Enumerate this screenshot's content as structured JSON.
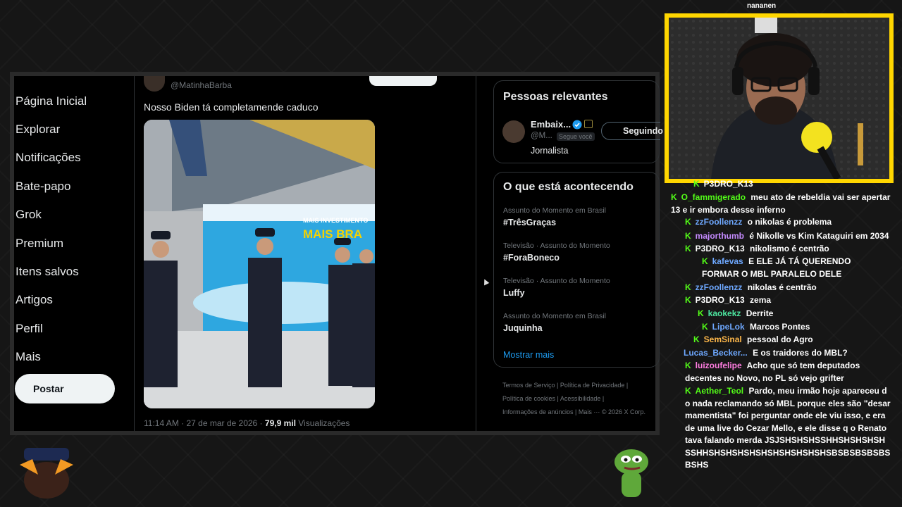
{
  "nav": {
    "items": [
      "Página Inicial",
      "Explorar",
      "Notificações",
      "Bate-papo",
      "Grok",
      "Premium",
      "Itens salvos",
      "Artigos",
      "Perfil",
      "Mais"
    ],
    "post_button": "Postar"
  },
  "tweet": {
    "handle": "@MatinhaBarba",
    "text": "Nosso Biden tá completamende caduco",
    "time": "11:14 AM · 27 de mar de 2026 ·",
    "views_count": "79,9 mil",
    "views_label": "Visualizações",
    "media_banner": "MAIS INVESTIMENTO",
    "media_banner2": "MAIS BRA"
  },
  "relevant": {
    "title": "Pessoas relevantes",
    "name": "Embaix...",
    "handle": "@M...",
    "follows_you": "Segue você",
    "bio": "Jornalista",
    "following_button": "Seguindo"
  },
  "trends": {
    "title": "O que está acontecendo",
    "items": [
      {
        "category": "Assunto do Momento em Brasil",
        "name": "#TrêsGraças"
      },
      {
        "category": "Televisão · Assunto do Momento",
        "name": "#ForaBoneco"
      },
      {
        "category": "Televisão · Assunto do Momento",
        "name": "Luffy"
      },
      {
        "category": "Assunto do Momento em Brasil",
        "name": "Juquinha"
      }
    ],
    "show_more": "Mostrar mais"
  },
  "footer": {
    "line1": "Termos de Serviço  |  Política de Privacidade  |",
    "line2": "Política de cookies  |  Acessibilidade  |",
    "line3": "Informações de anúncios  |  Mais ···  © 2026 X Corp."
  },
  "chat": {
    "top_cut": "nananen",
    "messages": [
      {
        "user": "P3DRO_K13",
        "color": "#ffffff",
        "text": "",
        "badge": true
      },
      {
        "user": "O_fammigerado",
        "color": "#53fc18",
        "text": "meu ato de rebeldia vai ser apertar 13 e ir embora desse inferno",
        "badge": true
      },
      {
        "user": "zzFoollenzz",
        "color": "#6ea8ff",
        "text": "o nikolas é problema",
        "badge": true
      },
      {
        "user": "majorthumb",
        "color": "#c58bff",
        "text": "é Nikolle vs Kim Kataguiri em 2034",
        "badge": true
      },
      {
        "user": "P3DRO_K13",
        "color": "#ffffff",
        "text": "nikolismo é centrão",
        "badge": true
      },
      {
        "user": "kafevas",
        "color": "#6ea8ff",
        "text": "E ELE JÁ TÁ QUERENDO FORMAR O MBL PARALELO DELE",
        "badge": true
      },
      {
        "user": "zzFoollenzz",
        "color": "#6ea8ff",
        "text": "nikolas é centrão",
        "badge": true
      },
      {
        "user": "P3DRO_K13",
        "color": "#ffffff",
        "text": "zema",
        "badge": true
      },
      {
        "user": "kaokekz",
        "color": "#4de6a0",
        "text": "Derrite",
        "badge": true
      },
      {
        "user": "LipeLok",
        "color": "#6ea8ff",
        "text": "Marcos Pontes",
        "badge": true
      },
      {
        "user": "SemSinal",
        "color": "#ffb84a",
        "text": "pessoal do Agro",
        "badge": true
      },
      {
        "user": "Lucas_Becker...",
        "color": "#6ea8ff",
        "text": "E os traidores do MBL?",
        "badge": false
      },
      {
        "user": "luizoufelipe",
        "color": "#ff7de0",
        "text": "Acho que só tem deputados decentes no Novo, no PL só vejo grifter",
        "badge": true
      },
      {
        "user": "Aether_Teol",
        "color": "#53fc18",
        "text": "Pardo, meu irmão hoje apareceu do nada reclamando só MBL porque eles são \"desarmamentista\" foi perguntar onde ele viu isso, e era de uma live do Cezar Mello, e ele disse q o Renato tava falando merda JSJSHSHSHSSHHSHSHSHSHSSHHSHSHSHSHSHSHSHSHSHSHSBSBSBSBSBSBSHS",
        "badge": true
      }
    ]
  }
}
